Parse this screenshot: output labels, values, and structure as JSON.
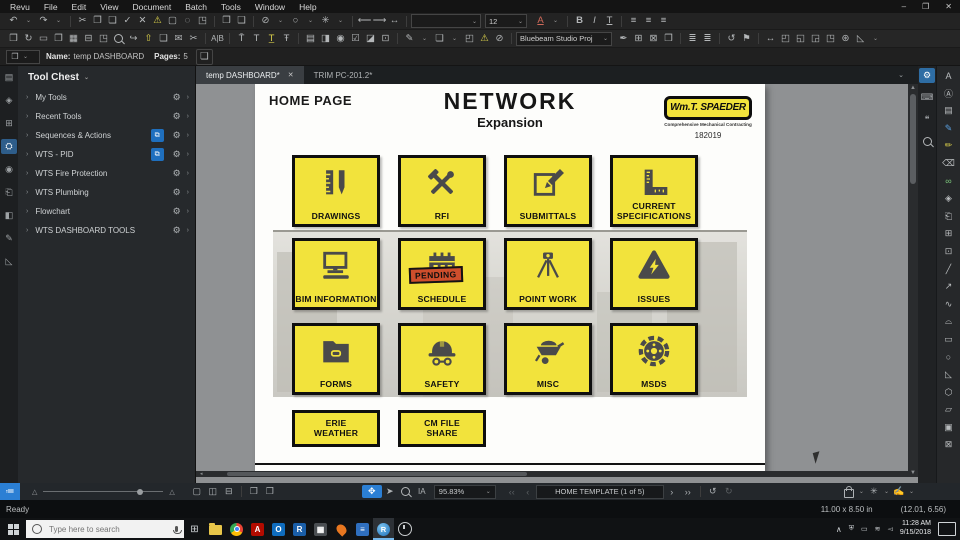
{
  "window": {
    "menus": [
      "Revu",
      "File",
      "Edit",
      "View",
      "Document",
      "Batch",
      "Tools",
      "Window",
      "Help"
    ],
    "controls": {
      "minimize": "–",
      "maximize": "❐",
      "close": "✕"
    }
  },
  "toolbar": {
    "font_size": "12",
    "color_letter": "A",
    "bold": "B",
    "italic": "I",
    "underline": "T",
    "studio_dropdown": "Bluebeam Studio Proj"
  },
  "doc_info": {
    "name_label": "Name:",
    "name_value": "temp DASHBOARD",
    "pages_label": "Pages:",
    "pages_value": "5"
  },
  "tool_chest": {
    "title": "Tool Chest",
    "items": [
      {
        "label": "My Tools"
      },
      {
        "label": "Recent Tools"
      },
      {
        "label": "Sequences & Actions"
      },
      {
        "label": "WTS - PID"
      },
      {
        "label": "WTS Fire Protection"
      },
      {
        "label": "WTS Plumbing"
      },
      {
        "label": "Flowchart"
      },
      {
        "label": "WTS DASHBOARD TOOLS"
      }
    ]
  },
  "tabs": [
    {
      "label": "temp DASHBOARD*"
    },
    {
      "label": "TRIM PC-201.2*"
    }
  ],
  "page": {
    "corner_label": "HOME PAGE",
    "title": "NETWORK",
    "subtitle": "Expansion",
    "logo": {
      "text": "Wm.T. SPAEDER",
      "tagline": "Comprehensive Mechanical Contracting",
      "number": "182019"
    },
    "tiles": [
      {
        "label": "DRAWINGS",
        "icon": "ruler-pencil"
      },
      {
        "label": "RFI",
        "icon": "crossed-tools"
      },
      {
        "label": "SUBMITTALS",
        "icon": "edit-square"
      },
      {
        "label": "CURRENT SPECIFICATIONS",
        "icon": "l-square"
      },
      {
        "label": "BIM INFORMATION",
        "icon": "computer"
      },
      {
        "label": "SCHEDULE",
        "icon": "calendar",
        "badge": "PENDING"
      },
      {
        "label": "POINT WORK",
        "icon": "survey-tripod"
      },
      {
        "label": "ISSUES",
        "icon": "hazard-bolt"
      },
      {
        "label": "FORMS",
        "icon": "folder"
      },
      {
        "label": "SAFETY",
        "icon": "hard-hat"
      },
      {
        "label": "MISC",
        "icon": "wheelbarrow"
      },
      {
        "label": "MSDS",
        "icon": "saw-blade"
      }
    ],
    "link_buttons": [
      {
        "label": "ERIE WEATHER"
      },
      {
        "label": "CM FILE SHARE"
      }
    ]
  },
  "status_bar": {
    "zoom_value": "95.83%",
    "page_nav": "HOME TEMPLATE (1 of 5)",
    "ready": "Ready",
    "page_size": "11.00 x 8.50 in",
    "coords": "(12.01, 6.56)"
  },
  "taskbar": {
    "search_placeholder": "Type here to search",
    "time": "11:28 AM",
    "date": "9/15/2018"
  },
  "colors": {
    "accent_blue": "#2b7fd4",
    "tile_yellow": "#f2e33c",
    "pending_red": "#cf4e2c"
  }
}
